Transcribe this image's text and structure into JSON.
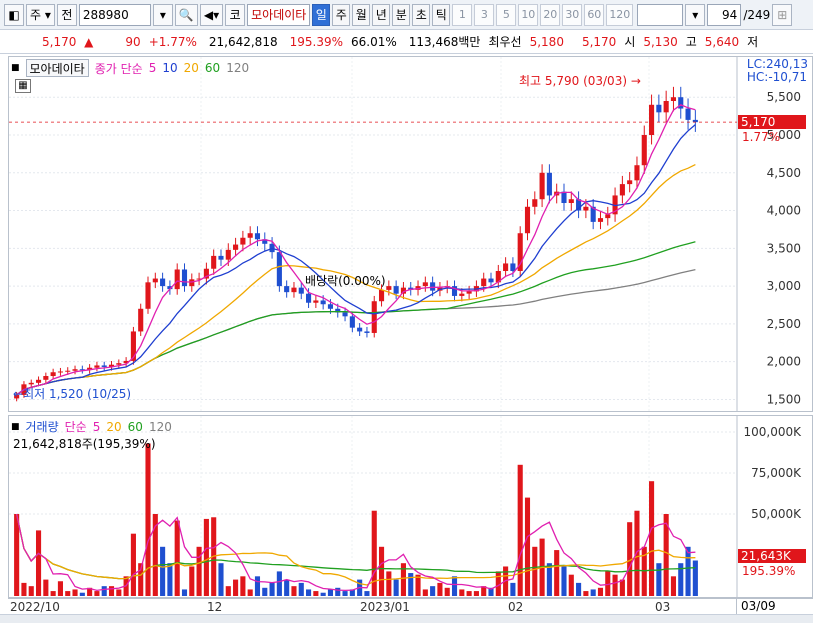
{
  "toolbar": {
    "market": "주",
    "jeon": "전",
    "code": "288980",
    "mode_badge": "코",
    "name": "모아데이타",
    "periods": [
      "일",
      "주",
      "월",
      "년",
      "분",
      "초",
      "틱"
    ],
    "active_period": "일",
    "intervals": [
      "1",
      "3",
      "5",
      "10",
      "20",
      "30",
      "60",
      "120"
    ],
    "page": "94",
    "page_total": "/249"
  },
  "info": {
    "price": "5,170",
    "change": "90",
    "change_pct": "+1.77%",
    "volume": "21,642,818",
    "vol_ratio": "195.39%",
    "rate": "66.01%",
    "amount": "113,468백만",
    "best_label": "최우선",
    "best_ask": "5,180",
    "best_bid": "5,170",
    "open_label": "시",
    "open": "5,130",
    "high_label": "고",
    "high": "5,640",
    "low_label": "저"
  },
  "price_panel": {
    "legend_name": "모아데이타",
    "legend_ma": "종가 단순",
    "ma_periods": [
      "5",
      "10",
      "20",
      "60",
      "120"
    ],
    "lc": "LC:240,13",
    "hc": "HC:-10,71",
    "current_badge": "5,170",
    "current_pct": "1.77%",
    "high_marker": "최고 5,790 (03/03)",
    "low_marker": "최저 1,520 (10/25)",
    "dividend_marker": "배당락(0.00%)",
    "y_ticks": [
      "5,500",
      "5,000",
      "4,500",
      "4,000",
      "3,500",
      "3,000",
      "2,500",
      "2,000",
      "1,500"
    ]
  },
  "volume_panel": {
    "legend_name": "거래량",
    "legend_ma": "단순",
    "ma_periods": [
      "5",
      "20",
      "60",
      "120"
    ],
    "sub_label": "21,642,818주(195,39%)",
    "y_ticks": [
      "100,000K",
      "75,000K",
      "50,000K"
    ],
    "current_badge": "21,643K",
    "current_pct": "195.39%"
  },
  "dates": [
    "2022/10",
    "12",
    "2023/01",
    "02",
    "03"
  ],
  "date_tail": "03/09",
  "colors": {
    "up": "#e0161b",
    "down": "#1f4fd0",
    "ma5": "#e020b0",
    "ma10": "#1f3fd0",
    "ma20": "#f0a800",
    "ma60": "#20a020",
    "ma120": "#808080"
  },
  "chart_data": [
    {
      "type": "candlestick",
      "ylabel": "",
      "ylim": [
        1400,
        5900
      ],
      "series": [
        {
          "name": "close",
          "values": [
            1560,
            1700,
            1720,
            1760,
            1810,
            1860,
            1870,
            1880,
            1900,
            1890,
            1920,
            1950,
            1930,
            1960,
            1980,
            2010,
            2400,
            2700,
            3050,
            3100,
            3000,
            2960,
            3220,
            3000,
            3090,
            3100,
            3230,
            3400,
            3350,
            3480,
            3550,
            3640,
            3700,
            3620,
            3560,
            3450,
            3000,
            2920,
            2980,
            2900,
            2780,
            2810,
            2760,
            2700,
            2650,
            2600,
            2450,
            2400,
            2380,
            2800,
            2950,
            3000,
            2900,
            2980,
            2950,
            3000,
            3050,
            2940,
            2980,
            3000,
            2870,
            2900,
            2930,
            3000,
            3100,
            3050,
            3200,
            3300,
            3200,
            3700,
            4050,
            4150,
            4500,
            4200,
            4250,
            4100,
            4150,
            4000,
            4050,
            3850,
            3900,
            3950,
            4200,
            4350,
            4400,
            4600,
            5000,
            5400,
            5300,
            5450,
            5500,
            5350,
            5200,
            5170
          ]
        }
      ]
    },
    {
      "type": "bar",
      "ylabel": "",
      "ylim": [
        0,
        100000
      ],
      "series": [
        {
          "name": "거래량",
          "values": [
            50000,
            8000,
            6000,
            40000,
            10000,
            3000,
            9000,
            3000,
            4000,
            2000,
            5000,
            3000,
            6000,
            6000,
            4000,
            12000,
            38000,
            20000,
            93000,
            50000,
            30000,
            20000,
            46000,
            4000,
            18000,
            30000,
            47000,
            48000,
            20000,
            6000,
            10000,
            12000,
            4000,
            12000,
            5000,
            8000,
            15000,
            10000,
            6000,
            8000,
            4000,
            3000,
            2000,
            4000,
            5000,
            3000,
            4000,
            10000,
            3000,
            52000,
            30000,
            15000,
            10000,
            20000,
            14000,
            13000,
            4000,
            6000,
            8000,
            5000,
            12000,
            4000,
            3000,
            3000,
            6000,
            5000,
            15000,
            18000,
            8000,
            80000,
            60000,
            30000,
            35000,
            20000,
            28000,
            18000,
            13000,
            8000,
            3000,
            4000,
            5000,
            15000,
            13000,
            10000,
            45000,
            52000,
            30000,
            70000,
            20000,
            50000,
            12000,
            20000,
            30000,
            21643
          ]
        }
      ]
    }
  ]
}
